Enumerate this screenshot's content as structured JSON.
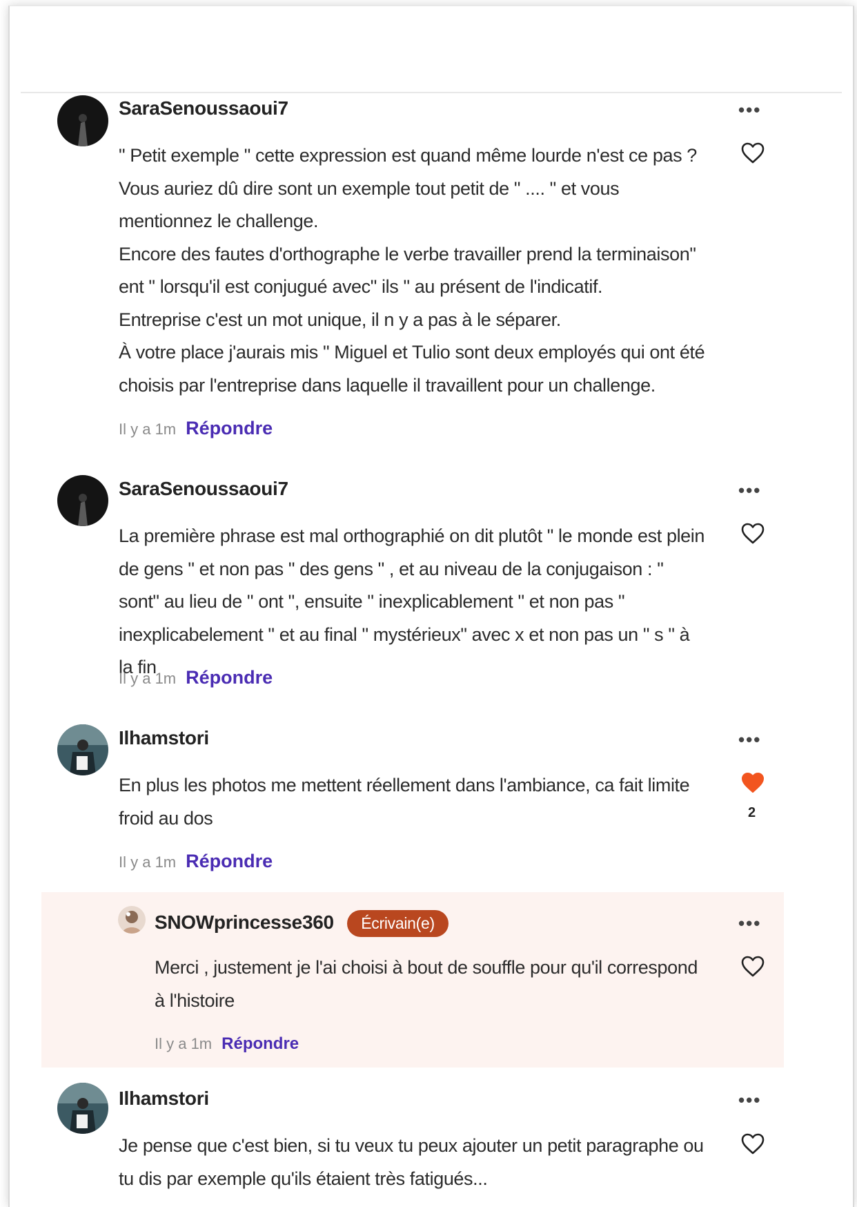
{
  "comments": [
    {
      "username": "SaraSenoussaoui7",
      "lines": [
        "\" Petit exemple \" cette expression est quand même lourde n'est ce pas ? Vous auriez dû dire sont un exemple tout petit de \" .... \" et vous mentionnez le challenge.",
        "Encore des fautes d'orthographe le verbe travailler prend la terminaison\" ent \" lorsqu'il est conjugué avec\" ils \" au présent de l'indicatif.",
        "Entreprise c'est un mot unique, il n y a pas à le séparer.",
        "À votre place j'aurais mis \" Miguel et Tulio sont deux employés qui ont été choisis par l'entreprise dans laquelle il travaillent pour un challenge."
      ],
      "time": "Il y a 1m",
      "reply_label": "Répondre",
      "liked": false
    },
    {
      "username": "SaraSenoussaoui7",
      "lines": [
        "La première phrase est mal orthographié on dit plutôt \" le monde est plein de gens \" et non pas \" des gens \" ,  et au niveau de la conjugaison : \" sont\" au lieu de \" ont \", ensuite \" inexplicablement \" et non pas \" inexplicabelement \" et au final \" mystérieux\" avec x et non pas un \" s \" à la fin"
      ],
      "time": "Il y a 1m",
      "reply_label": "Répondre",
      "liked": false
    },
    {
      "username": "Ilhamstori",
      "lines": [
        "En plus les photos me mettent réellement dans l'ambiance, ca fait limite froid au dos"
      ],
      "time": "Il y a 1m",
      "reply_label": "Répondre",
      "liked": true,
      "like_count": "2"
    },
    {
      "username": "SNOWprincesse360",
      "badge": "Écrivain(e)",
      "lines": [
        "Merci , justement je l'ai choisi à bout de souffle pour qu'il correspond à l'histoire"
      ],
      "time": "Il y a 1m",
      "reply_label": "Répondre",
      "liked": false,
      "is_reply": true
    },
    {
      "username": "Ilhamstori",
      "lines": [
        "Je pense que c'est bien, si tu veux tu peux ajouter un petit paragraphe ou tu dis par exemple qu'ils étaient très fatigués..."
      ],
      "liked": false
    }
  ],
  "more_label": "•••",
  "colors": {
    "reply_link": "#4a2cb3",
    "liked_heart": "#f2551f",
    "badge_bg": "#b9471f",
    "reply_bg": "#fdf3f0"
  }
}
